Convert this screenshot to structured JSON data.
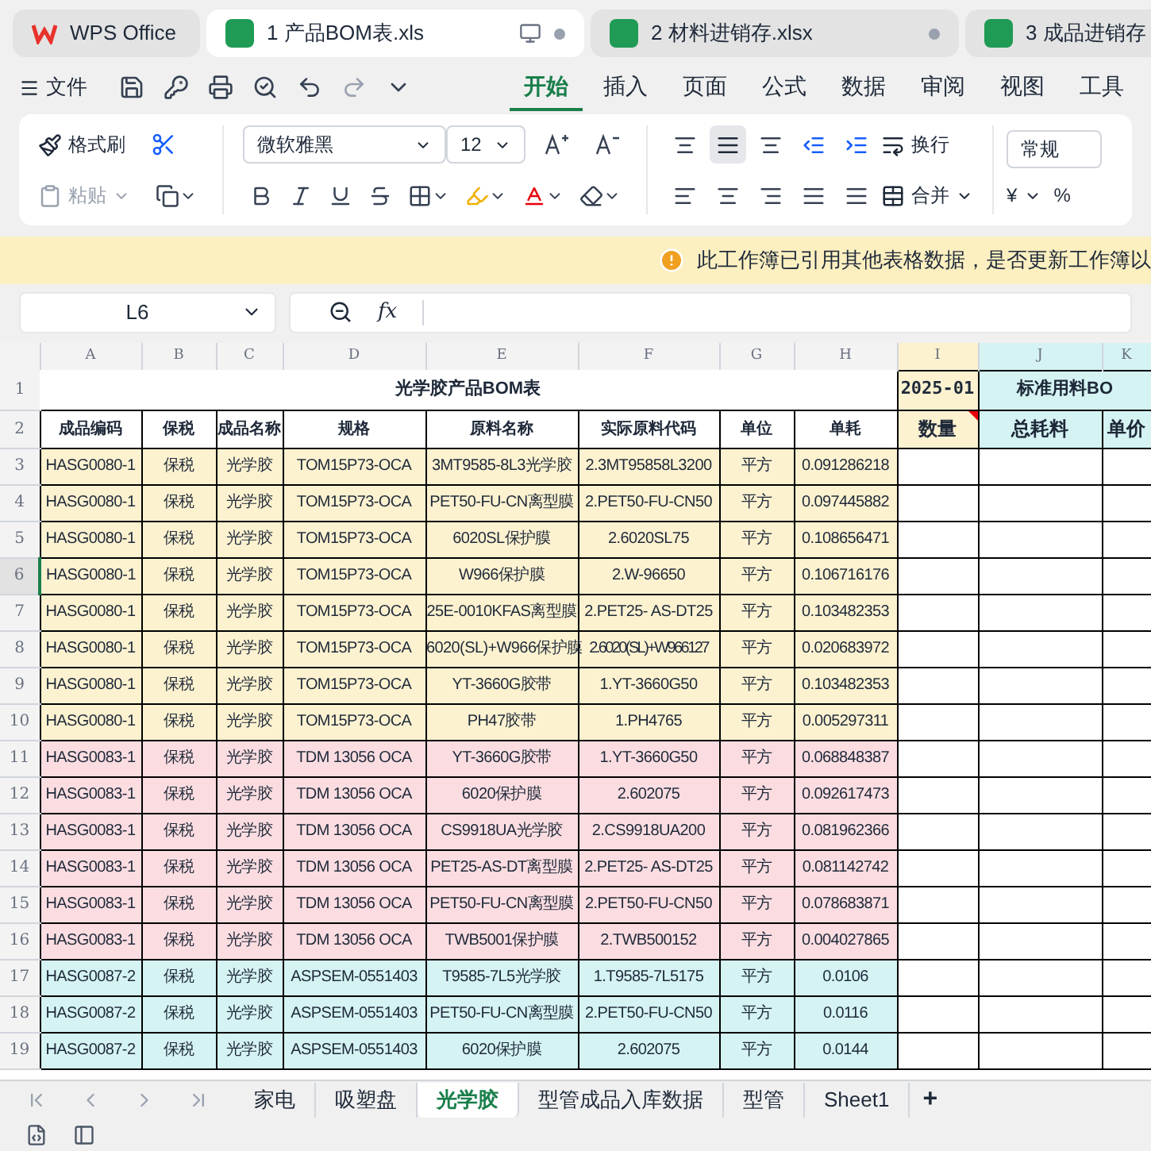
{
  "app_tabs": [
    {
      "label": "WPS Office",
      "kind": "home",
      "selected": false
    },
    {
      "label": "1 产品BOM表.xls",
      "kind": "sheet",
      "selected": true
    },
    {
      "label": "2 材料进销存.xlsx",
      "kind": "sheet",
      "selected": false
    },
    {
      "label": "3 成品进销存",
      "kind": "sheet",
      "selected": false
    }
  ],
  "file_menu": "文件",
  "menu_tabs": [
    {
      "label": "开始",
      "selected": true
    },
    {
      "label": "插入",
      "selected": false
    },
    {
      "label": "页面",
      "selected": false
    },
    {
      "label": "公式",
      "selected": false
    },
    {
      "label": "数据",
      "selected": false
    },
    {
      "label": "审阅",
      "selected": false
    },
    {
      "label": "视图",
      "selected": false
    },
    {
      "label": "工具",
      "selected": false
    }
  ],
  "ribbon": {
    "format_painter": "格式刷",
    "paste": {
      "label": "粘贴",
      "disabled": true
    },
    "font": "微软雅黑",
    "size": "12",
    "wrap": "换行",
    "merge": "合并",
    "number_format": "常规",
    "currency": "¥",
    "percent": "%"
  },
  "notice": "此工作簿已引用其他表格数据，是否更新工作簿以",
  "name_box": "L6",
  "formula_label": "fx",
  "columns": [
    "A",
    "B",
    "C",
    "D",
    "E",
    "F",
    "G",
    "H",
    "I",
    "J",
    "K"
  ],
  "title_row": "1",
  "header_row": "2",
  "title": "光学胶产品BOM表",
  "period": "2025-01",
  "group_title": "标准用料BO",
  "headers": [
    "成品编码",
    "保税",
    "成品名称",
    "规格",
    "原料名称",
    "实际原料代码",
    "单位",
    "单耗",
    "数量",
    "总耗料",
    "单价"
  ],
  "rows": [
    {
      "n": "3",
      "selected": false,
      "color": "#fdf2d0",
      "cells": [
        "HASG0080-1",
        "保税",
        "光学胶",
        "TOM15P73-OCA",
        "3MT9585-8L3光学胶",
        "2.3MT95858L3200",
        "平方",
        "0.091286218"
      ]
    },
    {
      "n": "4",
      "selected": false,
      "color": "#fdf2d0",
      "cells": [
        "HASG0080-1",
        "保税",
        "光学胶",
        "TOM15P73-OCA",
        "PET50-FU-CN离型膜",
        "2.PET50-FU-CN50",
        "平方",
        "0.097445882"
      ]
    },
    {
      "n": "5",
      "selected": false,
      "color": "#fdf2d0",
      "cells": [
        "HASG0080-1",
        "保税",
        "光学胶",
        "TOM15P73-OCA",
        "6020SL保护膜",
        "2.6020SL75",
        "平方",
        "0.108656471"
      ]
    },
    {
      "n": "6",
      "selected": true,
      "color": "#fdf2d0",
      "cells": [
        "HASG0080-1",
        "保税",
        "光学胶",
        "TOM15P73-OCA",
        "W966保护膜",
        "2.W-96650",
        "平方",
        "0.106716176"
      ]
    },
    {
      "n": "7",
      "selected": false,
      "color": "#fdf2d0",
      "cells": [
        "HASG0080-1",
        "保税",
        "光学胶",
        "TOM15P73-OCA",
        "25E-0010KFAS离型膜",
        "2.PET25- AS-DT25",
        "平方",
        "0.103482353"
      ]
    },
    {
      "n": "8",
      "selected": false,
      "color": "#fdf2d0",
      "cells": [
        "HASG0080-1",
        "保税",
        "光学胶",
        "TOM15P73-OCA",
        "6020(SL)+W966保护膜",
        "2.6020(SL)+W966127",
        "平方",
        "0.020683972"
      ]
    },
    {
      "n": "9",
      "selected": false,
      "color": "#fdf2d0",
      "cells": [
        "HASG0080-1",
        "保税",
        "光学胶",
        "TOM15P73-OCA",
        "YT-3660G胶带",
        "1.YT-3660G50",
        "平方",
        "0.103482353"
      ]
    },
    {
      "n": "10",
      "selected": false,
      "color": "#fdf2d0",
      "cells": [
        "HASG0080-1",
        "保税",
        "光学胶",
        "TOM15P73-OCA",
        "PH47胶带",
        "1.PH4765",
        "平方",
        "0.005297311"
      ]
    },
    {
      "n": "11",
      "selected": false,
      "color": "#fbdde1",
      "cells": [
        "HASG0083-1",
        "保税",
        "光学胶",
        "TDM 13056 OCA",
        "YT-3660G胶带",
        "1.YT-3660G50",
        "平方",
        "0.068848387"
      ]
    },
    {
      "n": "12",
      "selected": false,
      "color": "#fbdde1",
      "cells": [
        "HASG0083-1",
        "保税",
        "光学胶",
        "TDM 13056 OCA",
        "6020保护膜",
        "2.602075",
        "平方",
        "0.092617473"
      ]
    },
    {
      "n": "13",
      "selected": false,
      "color": "#fbdde1",
      "cells": [
        "HASG0083-1",
        "保税",
        "光学胶",
        "TDM 13056 OCA",
        "CS9918UA光学胶",
        "2.CS9918UA200",
        "平方",
        "0.081962366"
      ]
    },
    {
      "n": "14",
      "selected": false,
      "color": "#fbdde1",
      "cells": [
        "HASG0083-1",
        "保税",
        "光学胶",
        "TDM 13056 OCA",
        "PET25-AS-DT离型膜",
        "2.PET25- AS-DT25",
        "平方",
        "0.081142742"
      ]
    },
    {
      "n": "15",
      "selected": false,
      "color": "#fbdde1",
      "cells": [
        "HASG0083-1",
        "保税",
        "光学胶",
        "TDM 13056 OCA",
        "PET50-FU-CN离型膜",
        "2.PET50-FU-CN50",
        "平方",
        "0.078683871"
      ]
    },
    {
      "n": "16",
      "selected": false,
      "color": "#fbdde1",
      "cells": [
        "HASG0083-1",
        "保税",
        "光学胶",
        "TDM 13056 OCA",
        "TWB5001保护膜",
        "2.TWB500152",
        "平方",
        "0.004027865"
      ]
    },
    {
      "n": "17",
      "selected": false,
      "color": "#d5f3f3",
      "cells": [
        "HASG0087-2",
        "保税",
        "光学胶",
        "ASPSEM-0551403",
        "T9585-7L5光学胶",
        "1.T9585-7L5175",
        "平方",
        "0.0106"
      ]
    },
    {
      "n": "18",
      "selected": false,
      "color": "#d5f3f3",
      "cells": [
        "HASG0087-2",
        "保税",
        "光学胶",
        "ASPSEM-0551403",
        "PET50-FU-CN离型膜",
        "2.PET50-FU-CN50",
        "平方",
        "0.0116"
      ]
    },
    {
      "n": "19",
      "selected": false,
      "color": "#d5f3f3",
      "cells": [
        "HASG0087-2",
        "保税",
        "光学胶",
        "ASPSEM-0551403",
        "6020保护膜",
        "2.602075",
        "平方",
        "0.0144"
      ]
    }
  ],
  "sheet_tabs": [
    {
      "label": "家电",
      "selected": false
    },
    {
      "label": "吸塑盘",
      "selected": false
    },
    {
      "label": "光学胶",
      "selected": true
    },
    {
      "label": "型管成品入库数据",
      "selected": false
    },
    {
      "label": "型管",
      "selected": false
    },
    {
      "label": "Sheet1",
      "selected": false
    }
  ],
  "add_sheet": "+"
}
